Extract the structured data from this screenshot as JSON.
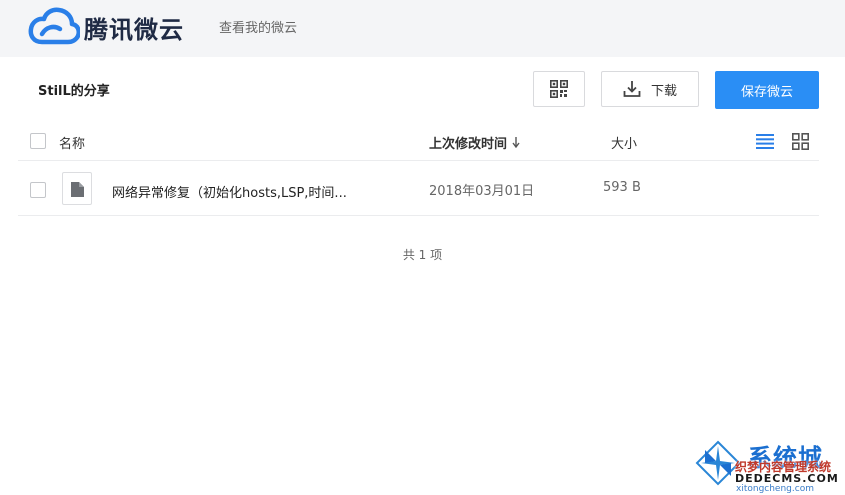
{
  "header": {
    "brand": "腾讯微云",
    "link_my_weiyun": "查看我的微云"
  },
  "share": {
    "title": "StilL的分享"
  },
  "toolbar": {
    "download_label": "下载",
    "save_label": "保存微云",
    "save_color": "#2a8ef5"
  },
  "table": {
    "columns": {
      "name": "名称",
      "mtime": "上次修改时间",
      "size": "大小"
    },
    "sort": "desc",
    "rows": [
      {
        "icon": "file-icon",
        "name": "网络异常修复（初始化hosts,LSP,时间...",
        "date": "2018年03月01日",
        "size": "593 B"
      }
    ],
    "total": "共 1 项"
  },
  "watermark": {
    "line1": "系统城",
    "line2": "织梦内容管理系统",
    "line3": "DEDECMS.COM",
    "line4": "xitongcheng.com"
  }
}
